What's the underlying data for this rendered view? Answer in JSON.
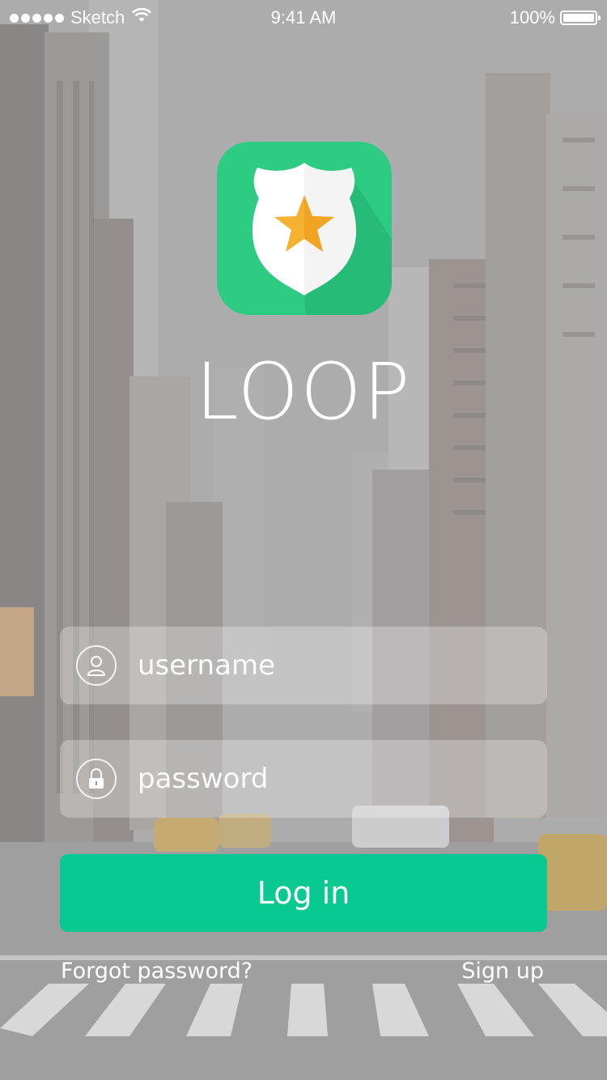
{
  "status_bar": {
    "carrier": "Sketch",
    "time": "9:41 AM",
    "battery": "100%",
    "battery_level": 1.0
  },
  "brand": {
    "name": "LOOP",
    "icon": "shield-star-icon",
    "icon_bg": "#2ecc83"
  },
  "form": {
    "username": {
      "value": "",
      "placeholder": "username",
      "icon": "user-icon"
    },
    "password": {
      "value": "",
      "placeholder": "password",
      "icon": "lock-icon"
    },
    "login_label": "Log in",
    "forgot_label": "Forgot password?",
    "signup_label": "Sign up"
  },
  "colors": {
    "accent": "#08c98f",
    "icon_green": "#2ecc83",
    "star": "#f5b130"
  }
}
